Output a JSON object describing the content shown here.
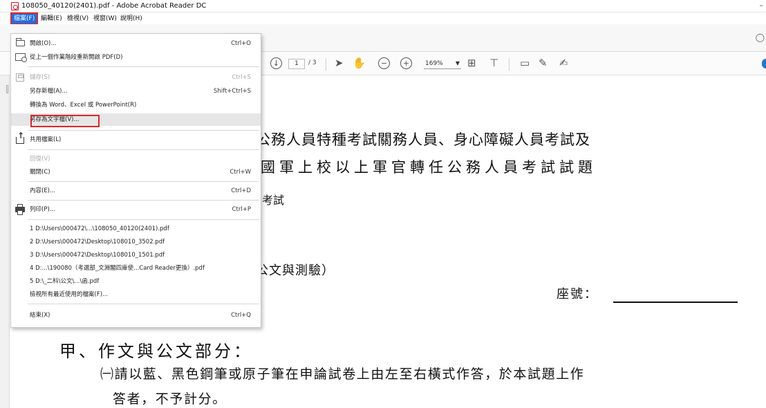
{
  "window": {
    "title": "108050_40120(2401).pdf - Adobe Acrobat Reader DC",
    "minimize_glyph": "–"
  },
  "menubar": {
    "items": [
      {
        "label": "檔案(F)",
        "active": true
      },
      {
        "label": "編輯(E)"
      },
      {
        "label": "檢視(V)"
      },
      {
        "label": "視窗(W)"
      },
      {
        "label": "說明(H)"
      }
    ]
  },
  "file_menu": {
    "items": [
      {
        "label": "開啟(O)...",
        "shortcut": "Ctrl+O",
        "icon": "folder-open-icon"
      },
      {
        "label": "從上一個作業階段重新開啟 PDF(D)",
        "shortcut": "",
        "icon": "reopen-icon"
      },
      {
        "label": "儲存(S)",
        "shortcut": "Ctrl+S",
        "icon": "save-icon",
        "disabled": true
      },
      {
        "label": "另存新檔(A)...",
        "shortcut": "Shift+Ctrl+S"
      },
      {
        "label": "轉換為 Word、Excel 或 PowerPoint(R)",
        "shortcut": ""
      },
      {
        "label": "另存為文字檔(V)...",
        "shortcut": "",
        "highlighted": true
      },
      {
        "label": "共用檔案(L)",
        "shortcut": "",
        "icon": "share-icon"
      },
      {
        "label": "回復(V)",
        "shortcut": "",
        "disabled": true
      },
      {
        "label": "關閉(C)",
        "shortcut": "Ctrl+W"
      },
      {
        "label": "內容(E)...",
        "shortcut": "Ctrl+D"
      },
      {
        "label": "列印(P)...",
        "shortcut": "Ctrl+P",
        "icon": "printer-icon"
      },
      {
        "label": "1 D:\\Users\\000472\\...\\108050_40120(2401).pdf",
        "shortcut": ""
      },
      {
        "label": "2 D:\\Users\\000472\\Desktop\\108010_3502.pdf",
        "shortcut": ""
      },
      {
        "label": "3 D:\\Users\\000472\\Desktop\\108010_1501.pdf",
        "shortcut": ""
      },
      {
        "label": "4 D:...\\190080（考選部_文淵閣四庫使...Card Reader更換）.pdf",
        "shortcut": ""
      },
      {
        "label": "5 D:\\_二科\\公文\\...\\函.pdf",
        "shortcut": ""
      },
      {
        "label": "檢視所有最近使用的檔案(F)...",
        "shortcut": ""
      },
      {
        "label": "結束(X)",
        "shortcut": "Ctrl+Q"
      }
    ]
  },
  "toolbar": {
    "current_page": "1",
    "page_total": "/ 3",
    "zoom": "169%"
  },
  "document": {
    "line1": "公務人員特種考試關務人員、身心障礙人員考試及",
    "line2": "國軍上校以上軍官轉任公務人員考試試題",
    "line3": "考試",
    "line4": "公文與測驗）",
    "seat_label": "座號：",
    "section_heading": "甲、作文與公文部分：",
    "para1": "㈠請以藍、黑色鋼筆或原子筆在申論試卷上由左至右橫式作答，於本試題上作",
    "para2": "答者，不予計分。"
  },
  "colors": {
    "menu_active_bg": "#1e6fe0",
    "highlight_outline": "#e0252b",
    "app_icon": "#dd1122"
  }
}
